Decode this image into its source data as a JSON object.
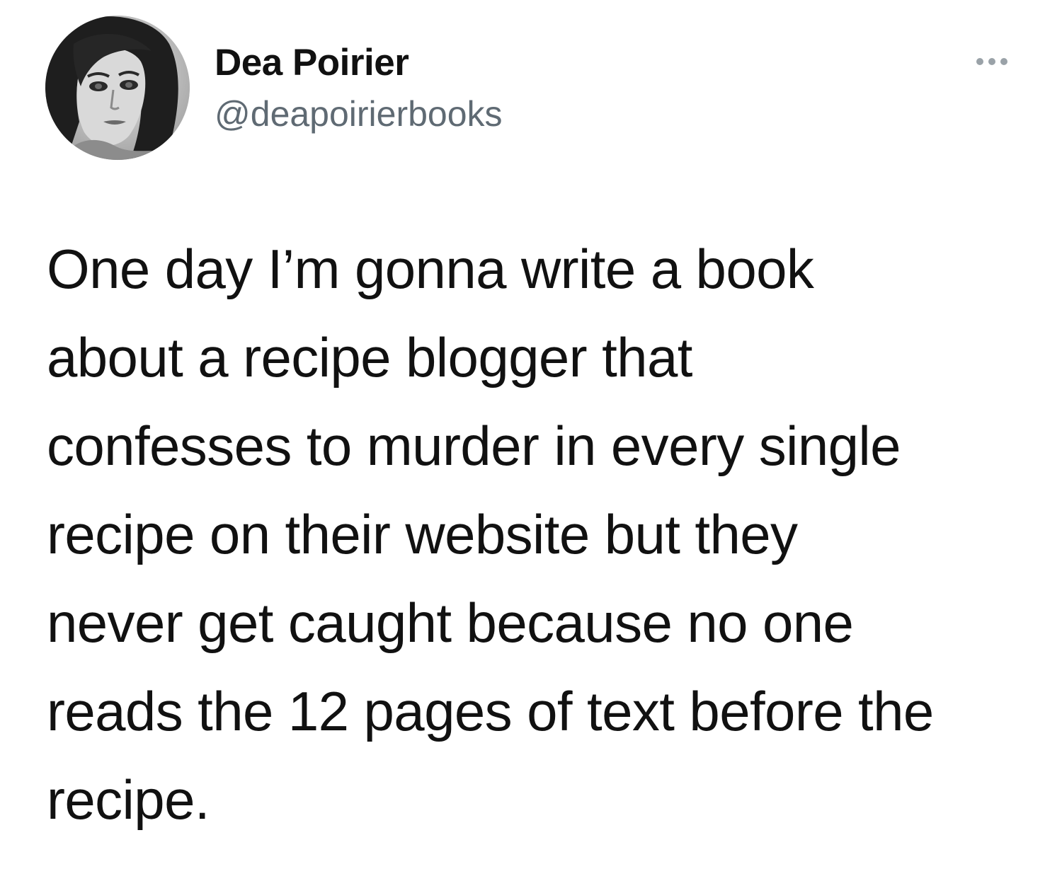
{
  "tweet": {
    "author": {
      "display_name": "Dea Poirier",
      "handle": "@deapoirierbooks",
      "avatar_icon": "profile-photo"
    },
    "more_icon": "more-options-icon",
    "text_lines": [
      "One day I’m gonna write a book",
      "about a recipe blogger that",
      "confesses to murder in every single",
      "recipe on their website but they",
      "never get caught because no one",
      "reads the 12 pages of text before the",
      "recipe."
    ]
  },
  "colors": {
    "background": "#ffffff",
    "text": "#111111",
    "handle": "#5f6a73",
    "more_dots": "#9aa2a8"
  }
}
